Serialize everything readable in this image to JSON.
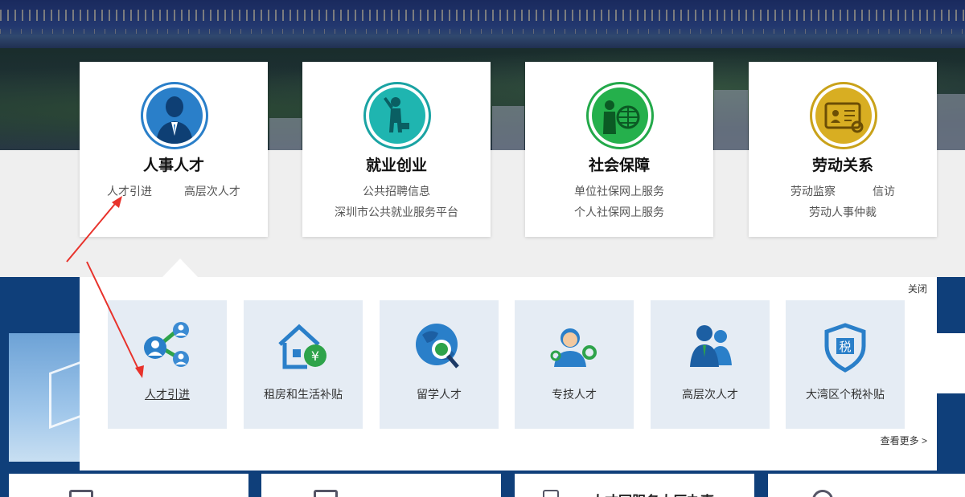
{
  "categories": [
    {
      "title": "人事人才",
      "links_row1": [
        "人才引进",
        "高层次人才"
      ],
      "links_row2": [],
      "icon": "personnel-icon",
      "color": "#2a7fc9"
    },
    {
      "title": "就业创业",
      "links_row1": [
        "公共招聘信息"
      ],
      "links_row2": [
        "深圳市公共就业服务平台"
      ],
      "icon": "employment-icon",
      "color": "#1aa3a3"
    },
    {
      "title": "社会保障",
      "links_row1": [
        "单位社保网上服务"
      ],
      "links_row2": [
        "个人社保网上服务"
      ],
      "icon": "social-security-icon",
      "color": "#23a94a"
    },
    {
      "title": "劳动关系",
      "links_row1": [
        "劳动监察",
        "信访"
      ],
      "links_row2": [
        "劳动人事仲裁"
      ],
      "icon": "labor-relations-icon",
      "color": "#c9a21a"
    }
  ],
  "popup": {
    "close_label": "关闭",
    "more_label": "查看更多 >",
    "tiles": [
      {
        "label": "人才引进",
        "icon": "talent-network-icon",
        "active": true
      },
      {
        "label": "租房和生活补贴",
        "icon": "house-subsidy-icon",
        "active": false
      },
      {
        "label": "留学人才",
        "icon": "globe-search-icon",
        "active": false
      },
      {
        "label": "专技人才",
        "icon": "technical-talent-icon",
        "active": false
      },
      {
        "label": "高层次人才",
        "icon": "senior-talent-icon",
        "active": false
      },
      {
        "label": "大湾区个税补贴",
        "icon": "tax-shield-icon",
        "active": false
      }
    ]
  },
  "bottom": {
    "card3_text": "人才园服务大厅办事"
  },
  "colors": {
    "blue_band": "#0f3f7a",
    "tile_bg": "#e5ecf4",
    "annotation_red": "#e8322b"
  }
}
